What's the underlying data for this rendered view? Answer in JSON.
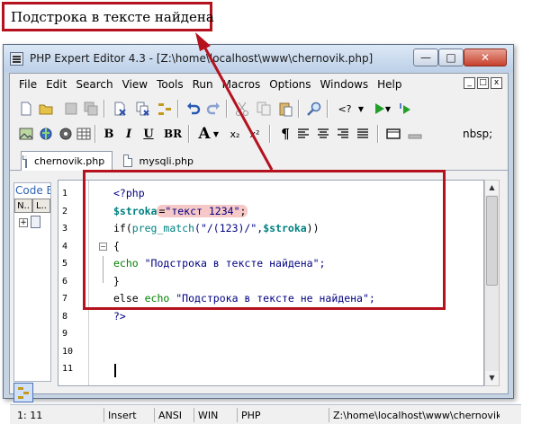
{
  "callout": {
    "text": "Подстрока в тексте найдена"
  },
  "window": {
    "title": "PHP Expert Editor 4.3 - [Z:\\home\\localhost\\www\\chernovik.php]",
    "min_glyph": "—",
    "max_glyph": "□",
    "close_glyph": "✕"
  },
  "menu": {
    "items": [
      "File",
      "Edit",
      "Search",
      "View",
      "Tools",
      "Run",
      "Macros",
      "Options",
      "Windows",
      "Help"
    ],
    "mdi_min": "_",
    "mdi_max": "□",
    "mdi_close": "x"
  },
  "toolbar": {
    "run_tag": "<?",
    "bold": "B",
    "italic": "I",
    "underline": "U",
    "br": "BR",
    "font_a": "A",
    "sub": "x₂",
    "sup": "x²",
    "para": "¶",
    "nbsp": "nbsp;"
  },
  "tabs": [
    {
      "label": "chernovik.php",
      "active": true
    },
    {
      "label": "mysqli.php",
      "active": false
    }
  ],
  "panel": {
    "label": "Code Explorer",
    "tab1": "N..",
    "tab2": "L.."
  },
  "editor": {
    "lines": [
      {
        "n": "1",
        "code": "<?php"
      },
      {
        "n": "2",
        "var": "$stroka",
        "eq": "=",
        "str": "\"текст 1234\"",
        "end": ";"
      },
      {
        "n": "3",
        "kw": "if(",
        "fn": "preg_match",
        "args1": "(\"/(123)/\",",
        "var": "$stroka",
        "args2": "))"
      },
      {
        "n": "4",
        "code": "{"
      },
      {
        "n": "5",
        "kw": "echo",
        "str": " \"Подстрока в тексте найдена\";"
      },
      {
        "n": "6",
        "code": "}"
      },
      {
        "n": "7",
        "kw0": "else ",
        "kw": "echo",
        "str": " \"Подстрока в тексте не найдена\";"
      },
      {
        "n": "8",
        "code": "?>"
      },
      {
        "n": "9",
        "code": ""
      },
      {
        "n": "10",
        "code": ""
      },
      {
        "n": "11",
        "code": ""
      }
    ]
  },
  "statusbar": {
    "position": "1: 11",
    "mode": "Insert",
    "encoding": "ANSI",
    "lineend": "WIN",
    "syntax": "PHP",
    "path": "Z:\\home\\localhost\\www\\chernovik.php"
  },
  "colors": {
    "highlight_border": "#b3121e",
    "php_tag": "#000080",
    "variable": "#008080",
    "echo": "#008000"
  }
}
